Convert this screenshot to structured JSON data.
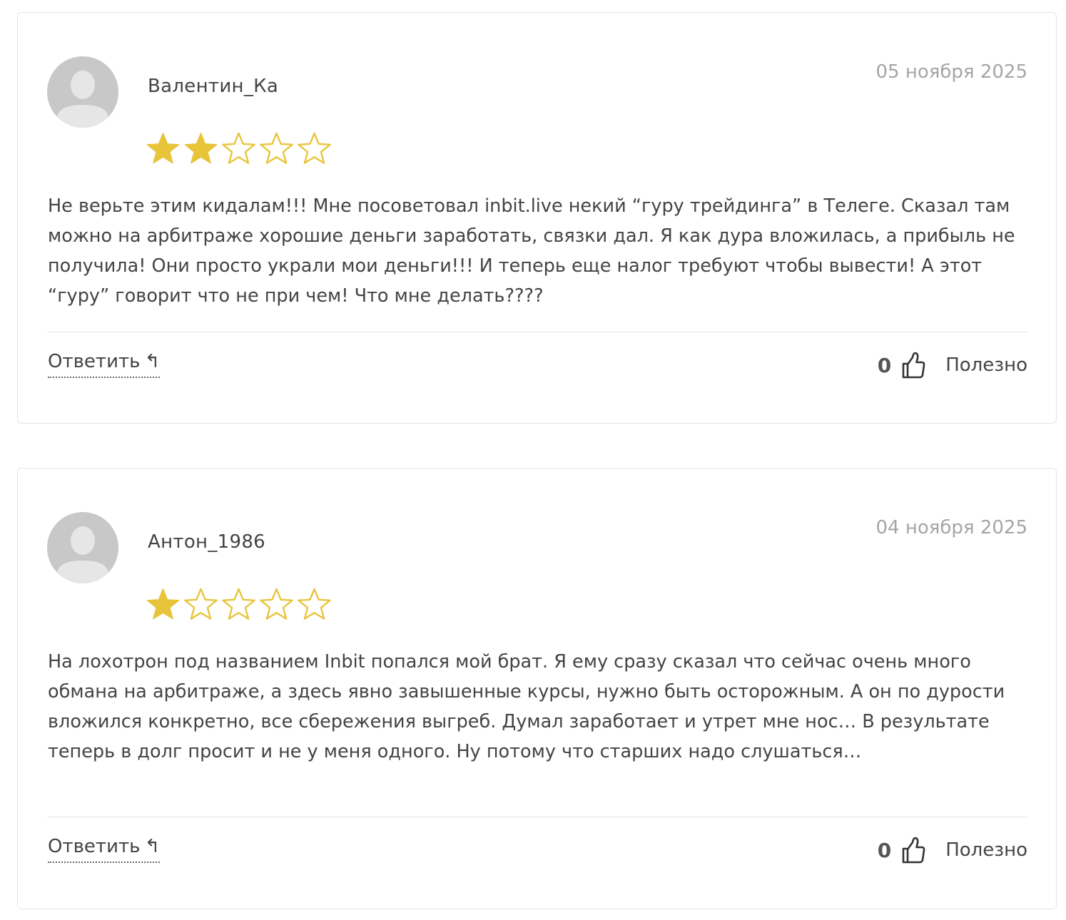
{
  "colors": {
    "star_filled": "#e8c43a",
    "star_empty_stroke": "#e8c43a",
    "avatar_bg": "#c8c8c8",
    "date_text": "#a5a5a5"
  },
  "reviews": [
    {
      "author": "Валентин_Ка",
      "date": "05 ноября 2025",
      "rating": 2,
      "rating_max": 5,
      "text": "Не верьте этим кидалам!!! Мне посоветовал inbit.live некий “гуру трейдинга” в Телеге. Сказал там можно на арбитраже хорошие деньги заработать, связки дал. Я как дура вложилась, а прибыль не получила! Они просто украли мои деньги!!! И теперь еще налог требуют чтобы вывести! А этот “гуру” говорит что не при чем! Что мне делать????",
      "reply_label": "Ответить",
      "reply_icon": "reply-arrow-icon",
      "helpful_count": "0",
      "helpful_label": "Полезно",
      "helpful_icon": "thumbs-up-icon"
    },
    {
      "author": "Антон_1986",
      "date": "04 ноября 2025",
      "rating": 1,
      "rating_max": 5,
      "text": "На лохотрон под названием Inbit попался мой брат. Я ему сразу сказал что сейчас очень много обмана на арбитраже, а здесь явно завышенные курсы, нужно быть осторожным. А он по дурости вложился конкретно, все сбережения выгреб. Думал заработает и утрет мне нос… В результате теперь в долг просит и не у меня одного. Ну потому что старших надо слушаться…",
      "reply_label": "Ответить",
      "reply_icon": "reply-arrow-icon",
      "helpful_count": "0",
      "helpful_label": "Полезно",
      "helpful_icon": "thumbs-up-icon"
    }
  ]
}
